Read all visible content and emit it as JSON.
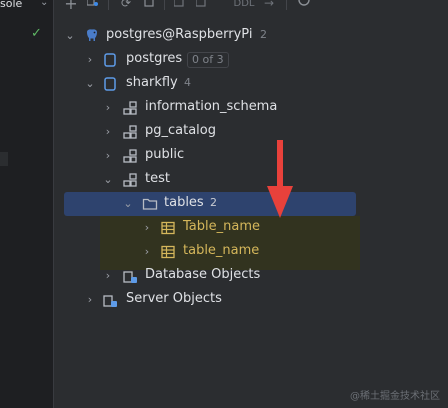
{
  "left_panel": {
    "console_tab_label": "sole",
    "status": "check"
  },
  "toolbar": {
    "plus": "+",
    "ddl_label": "DDL"
  },
  "tree": {
    "connection": {
      "label": "postgres@RaspberryPi",
      "count": "2"
    },
    "postgres_db": {
      "label": "postgres",
      "badge": "0 of 3"
    },
    "sharkfly_db": {
      "label": "sharkfly",
      "count": "4"
    },
    "schemas": [
      {
        "label": "information_schema"
      },
      {
        "label": "pg_catalog"
      },
      {
        "label": "public"
      },
      {
        "label": "test"
      }
    ],
    "tables_folder": {
      "label": "tables",
      "count": "2"
    },
    "tables": [
      {
        "label": "Table_name"
      },
      {
        "label": "table_name"
      }
    ],
    "database_objects": {
      "label": "Database Objects"
    },
    "server_objects": {
      "label": "Server Objects"
    }
  },
  "colors": {
    "background": "#2b2d30",
    "selection": "#2e436e",
    "highlight": "#32331f",
    "table_text": "#d5b75b",
    "annotation_arrow": "#e8413b"
  },
  "watermark": "@稀土掘金技术社区"
}
